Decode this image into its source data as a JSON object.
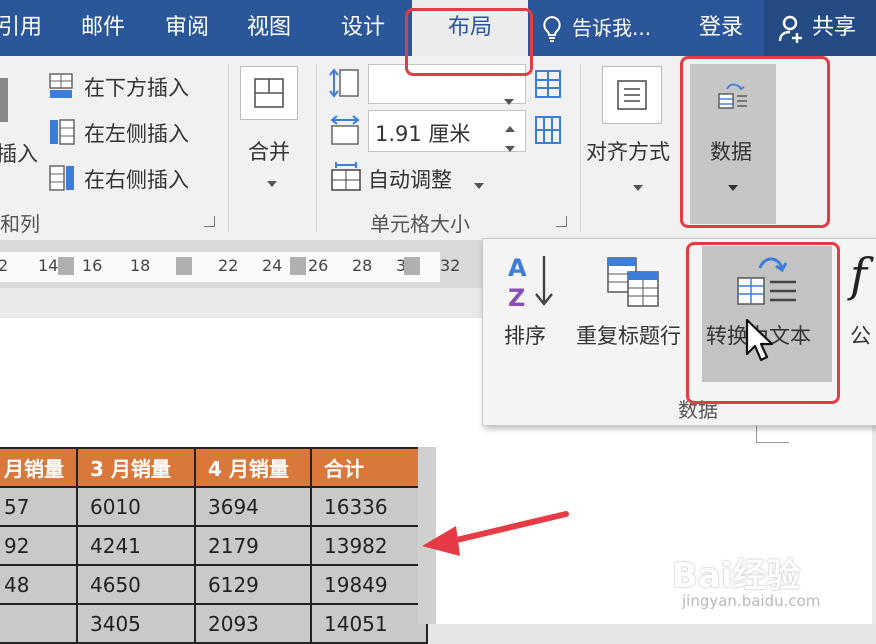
{
  "tabs": {
    "references": "引用",
    "mailings": "邮件",
    "review": "审阅",
    "view": "视图",
    "design": "设计",
    "layout": "布局",
    "tell_me": "告诉我...",
    "login": "登录",
    "share": "共享"
  },
  "ribbon": {
    "insert_below": "在下方插入",
    "insert_left": "在左侧插入",
    "insert_right": "在右侧插入",
    "insert_partial": "插入",
    "rows_cols_group": "和列",
    "merge": "合并",
    "width_value": "1.91 厘米",
    "auto_fit": "自动调整",
    "cell_size_group": "单元格大小",
    "alignment": "对齐方式",
    "data": "数据"
  },
  "ruler": {
    "ticks": [
      "2",
      "14",
      "16",
      "18",
      "22",
      "24",
      "26",
      "28",
      "3",
      "32"
    ]
  },
  "dropdown": {
    "sort": "排序",
    "repeat_header": "重复标题行",
    "convert_to_text": "转换为文本",
    "formula_partial": "公",
    "group_label": "数据"
  },
  "table": {
    "headers": [
      "月销量",
      "3 月销量",
      "4 月销量",
      "合计"
    ],
    "rows": [
      [
        "57",
        "6010",
        "3694",
        "16336"
      ],
      [
        "92",
        "4241",
        "2179",
        "13982"
      ],
      [
        "48",
        "4650",
        "6129",
        "19849"
      ],
      [
        "",
        "3405",
        "2093",
        "14051"
      ]
    ]
  },
  "watermark": {
    "text": "Bai经验",
    "url": "jingyan.baidu.com"
  },
  "colors": {
    "ribbon_blue": "#2b579a",
    "table_header": "#d9783a",
    "highlight_red": "#e63a45"
  }
}
